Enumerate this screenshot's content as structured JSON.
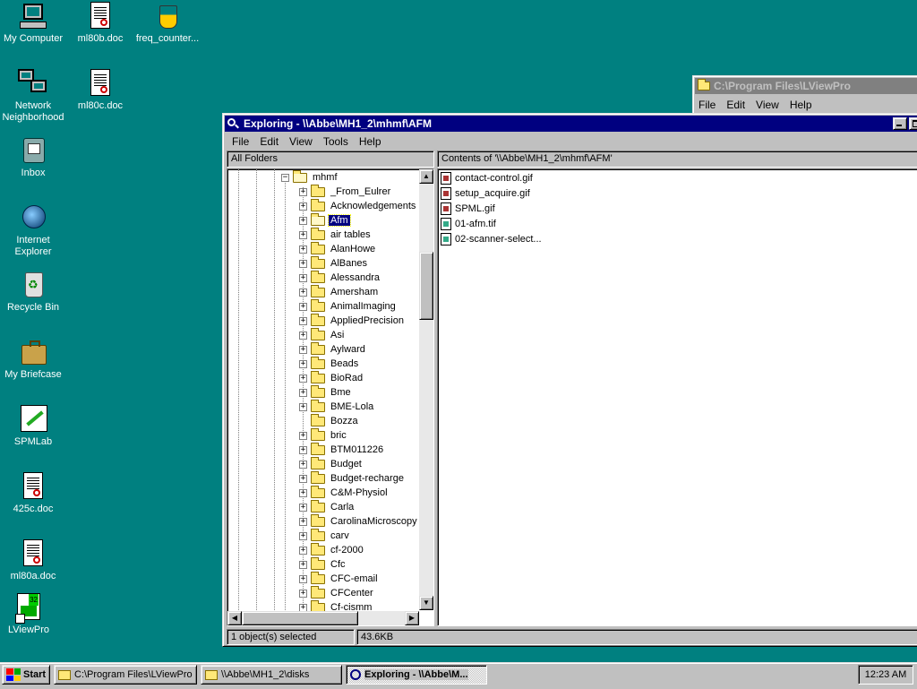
{
  "desktop_icons": [
    {
      "label": "My Computer",
      "icon": "my-computer-icon"
    },
    {
      "label": "ml80b.doc",
      "icon": "document-icon"
    },
    {
      "label": "freq_counter...",
      "icon": "program-icon"
    },
    {
      "label": "Network Neighborhood",
      "icon": "network-icon"
    },
    {
      "label": "ml80c.doc",
      "icon": "document-icon"
    },
    {
      "label": "Inbox",
      "icon": "inbox-icon"
    },
    {
      "label": "Internet Explorer",
      "icon": "internet-explorer-icon"
    },
    {
      "label": "Recycle Bin",
      "icon": "recycle-bin-icon"
    },
    {
      "label": "My Briefcase",
      "icon": "briefcase-icon"
    },
    {
      "label": "SPMLab",
      "icon": "spmlab-icon"
    },
    {
      "label": "425c.doc",
      "icon": "document-icon"
    },
    {
      "label": "ml80a.doc",
      "icon": "document-icon"
    },
    {
      "label": "LViewPro",
      "icon": "lviewpro-shortcut-icon"
    }
  ],
  "back_window": {
    "title": "C:\\Program Files\\LViewPro",
    "menu": [
      "File",
      "Edit",
      "View",
      "Help"
    ]
  },
  "explorer": {
    "title": "Exploring - \\\\Abbe\\MH1_2\\mhmf\\AFM",
    "menu": [
      "File",
      "Edit",
      "View",
      "Tools",
      "Help"
    ],
    "all_folders_label": "All Folders",
    "contents_label": "Contents of '\\\\Abbe\\MH1_2\\mhmf\\AFM'",
    "tree_root": "mhmf",
    "tree_items": [
      {
        "label": "_From_Eulrer",
        "expand": "+"
      },
      {
        "label": "Acknowledgements",
        "expand": "+"
      },
      {
        "label": "Afm",
        "expand": "+",
        "selected": true
      },
      {
        "label": "air tables",
        "expand": "+"
      },
      {
        "label": "AlanHowe",
        "expand": "+"
      },
      {
        "label": "AlBanes",
        "expand": "+"
      },
      {
        "label": "Alessandra",
        "expand": "+"
      },
      {
        "label": "Amersham",
        "expand": "+"
      },
      {
        "label": "AnimalImaging",
        "expand": "+"
      },
      {
        "label": "AppliedPrecision",
        "expand": "+"
      },
      {
        "label": "Asi",
        "expand": "+"
      },
      {
        "label": "Aylward",
        "expand": "+"
      },
      {
        "label": "Beads",
        "expand": "+"
      },
      {
        "label": "BioRad",
        "expand": "+"
      },
      {
        "label": "Bme",
        "expand": "+"
      },
      {
        "label": "BME-Lola",
        "expand": "+"
      },
      {
        "label": "Bozza",
        "expand": ""
      },
      {
        "label": "bric",
        "expand": "+"
      },
      {
        "label": "BTM011226",
        "expand": "+"
      },
      {
        "label": "Budget",
        "expand": "+"
      },
      {
        "label": "Budget-recharge",
        "expand": "+"
      },
      {
        "label": "C&M-Physiol",
        "expand": "+"
      },
      {
        "label": "Carla",
        "expand": "+"
      },
      {
        "label": "CarolinaMicroscopy",
        "expand": "+"
      },
      {
        "label": "carv",
        "expand": "+"
      },
      {
        "label": "cf-2000",
        "expand": "+"
      },
      {
        "label": "Cfc",
        "expand": "+"
      },
      {
        "label": "CFC-email",
        "expand": "+"
      },
      {
        "label": "CFCenter",
        "expand": "+"
      },
      {
        "label": "Cf-cismm",
        "expand": "+"
      }
    ],
    "files": [
      {
        "name": "contact-control.gif",
        "type": "gif"
      },
      {
        "name": "setup_acquire.gif",
        "type": "gif"
      },
      {
        "name": "SPML.gif",
        "type": "gif"
      },
      {
        "name": "01-afm.tif",
        "type": "tif"
      },
      {
        "name": "02-scanner-select...",
        "type": "tif"
      }
    ],
    "status": {
      "selection": "1 object(s) selected",
      "size": "43.6KB"
    }
  },
  "taskbar": {
    "start_label": "Start",
    "tasks": [
      {
        "label": "C:\\Program Files\\LViewPro",
        "active": false
      },
      {
        "label": "\\\\Abbe\\MH1_2\\disks",
        "active": false
      },
      {
        "label": "Exploring - \\\\Abbe\\M...",
        "active": true
      }
    ],
    "clock": "12:23 AM"
  },
  "colors": {
    "desktop": "#008080",
    "title_active": "#000080",
    "title_inactive": "#808080",
    "face": "#c0c0c0"
  }
}
